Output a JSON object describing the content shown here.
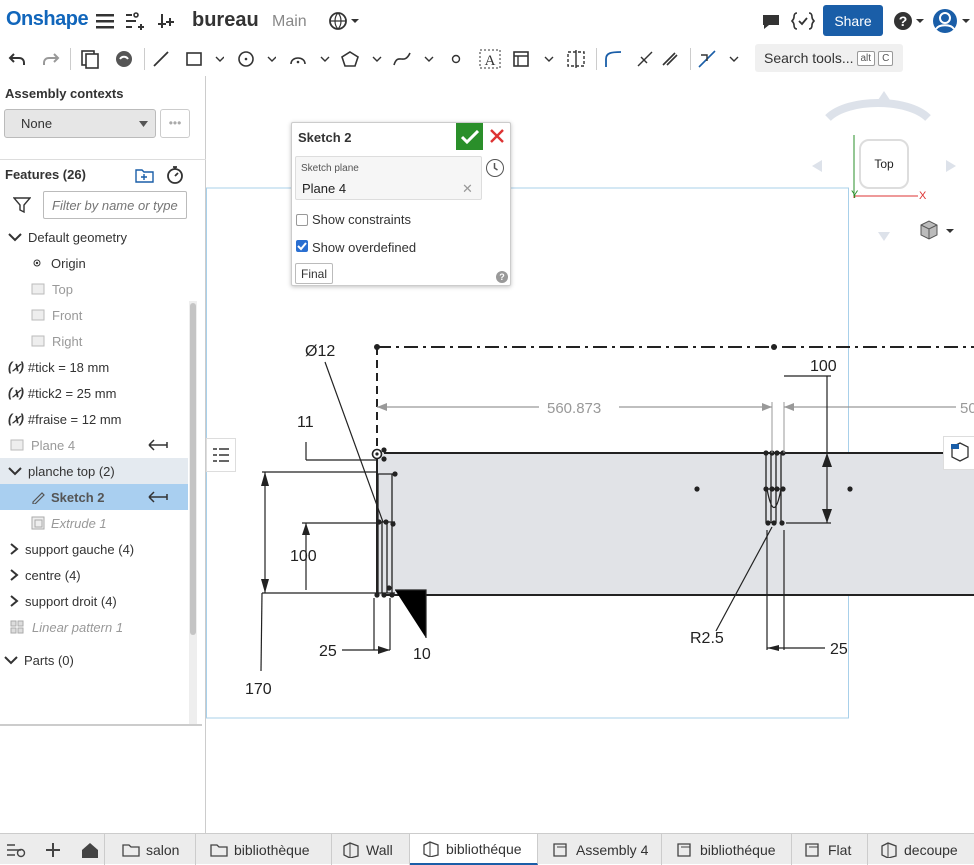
{
  "app": {
    "logo": "Onshape"
  },
  "document": {
    "title": "bureau",
    "branch": "Main"
  },
  "header": {
    "share_label": "Share"
  },
  "toolbar": {
    "search_label": "Search tools...",
    "shortcut_1": "alt",
    "shortcut_2": "C"
  },
  "left_panel": {
    "context_label": "Assembly contexts",
    "context_value": "None",
    "features_title": "Features (26)",
    "filter_placeholder": "Filter by name or type",
    "tree": [
      {
        "label": "Default geometry",
        "kind": "group-open"
      },
      {
        "label": "Origin",
        "kind": "origin"
      },
      {
        "label": "Top",
        "kind": "plane"
      },
      {
        "label": "Front",
        "kind": "plane"
      },
      {
        "label": "Right",
        "kind": "plane"
      },
      {
        "label": "#tick = 18 mm",
        "kind": "variable"
      },
      {
        "label": "#tick2 = 25 mm",
        "kind": "variable"
      },
      {
        "label": "#fraise = 12 mm",
        "kind": "variable"
      },
      {
        "label": "Plane 4",
        "kind": "plane-dim"
      },
      {
        "label": "planche top (2)",
        "kind": "group-open"
      },
      {
        "label": "Sketch 2",
        "kind": "sketch-selected"
      },
      {
        "label": "Extrude 1",
        "kind": "extrude-rolled"
      },
      {
        "label": "support gauche (4)",
        "kind": "group-closed"
      },
      {
        "label": "centre (4)",
        "kind": "group-closed"
      },
      {
        "label": "support droit (4)",
        "kind": "group-closed"
      },
      {
        "label": "Linear pattern 1",
        "kind": "pattern-rolled"
      }
    ],
    "parts_label": "Parts (0)"
  },
  "sketch_dialog": {
    "title": "Sketch 2",
    "plane_label": "Sketch plane",
    "plane_value": "Plane 4",
    "show_constraints": "Show constraints",
    "show_constraints_checked": false,
    "show_overdefined": "Show overdefined",
    "show_overdefined_checked": true,
    "final_label": "Final",
    "help": "?"
  },
  "viewcube": {
    "face": "Top",
    "axis_y": "Y",
    "axis_x": "X"
  },
  "sketch_dimensions": {
    "diameter": "Ø12",
    "d11": "11",
    "d100_left": "100",
    "d170": "170",
    "d25_left": "25",
    "d10": "10",
    "d560": "560.873",
    "d50_partial": "50",
    "d100_right": "100",
    "r25": "R2.5",
    "d25_right": "25"
  },
  "bottom_tabs": [
    {
      "label": "salon",
      "icon": "folder-icon"
    },
    {
      "label": "bibliothèque",
      "icon": "folder-icon"
    },
    {
      "label": "Wall",
      "icon": "partstudio-icon"
    },
    {
      "label": "bibliothéque",
      "icon": "partstudio-icon",
      "active": true
    },
    {
      "label": "Assembly 4",
      "icon": "assembly-icon"
    },
    {
      "label": "bibliothéque",
      "icon": "assembly-icon"
    },
    {
      "label": "Flat",
      "icon": "assembly-icon"
    },
    {
      "label": "decoupe",
      "icon": "partstudio-icon"
    }
  ],
  "colors": {
    "accent": "#1a5ea8",
    "ok": "#2a8f2a",
    "cancel": "#dd3333",
    "selection": "#a9cff0"
  }
}
